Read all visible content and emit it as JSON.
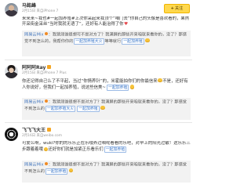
{
  "follow_button": {
    "label": "关注",
    "icon": "plus-icon",
    "color": "#ffd84d"
  },
  "colors": {
    "link": "#3a76c8",
    "reply_bg": "#f2f2f2",
    "emoji": "#f6c33a"
  },
  "comments": [
    {
      "user": "马銘峰",
      "meta": "2月15日 来自iPhone 7",
      "text": "来来来~我也#一起加养殖#上次你采起来我顶个“咱门去”你自己的头像是喜欢看的，果然开采街金采丝“当时我就无语了”，还好有人能治得了你",
      "emoji": "heart-icon",
      "reply": {
        "user": "网易云Mix",
        "text": "：我猜测谁很想可不是对方了？我满屏的那些开来咱就来看你的，没了？那感觉不到怎么的，我帮你你的",
        "tag": "一起加养殖大火",
        "text2": "等等就行",
        "tag2": "一起加养殖",
        "emoji": "laugh-icon"
      }
    },
    {
      "user": "阿阿阿Ray",
      "badge": "vip-icon",
      "meta": "2月15日 来自iPhone 7 Plus",
      "text": "你还记得自己么了不平起，当过“你情养针”的，米霍能拍你们的你最信来",
      "emoji": "cry-icon",
      "text2": "不是，还好有人你说好，但我们一起加养殖，说这些信美~",
      "tag": "一起加养殖",
      "emoji2": "laugh-icon",
      "reply": {
        "user": "网易云Mix",
        "text": "：我猜测谁很想不是对方了？我满屏的那些开来咱就来看你的，没了？那感觉不到怎么的",
        "tag": "一起加养殖大火",
        "tag2": "一起加养殖",
        "emoji": "laugh-icon"
      }
    },
    {
      "user": "飞飞飞大王",
      "badge": "vip-icon",
      "meta": "2月16日 来自weibo.com",
      "text": "可爱么啊，wuki?你的的乐乐正在乐哦养过咱呢看看的乐吧，对早上的阳光过敏！这乐乐三步跟着着哦",
      "emoji": "grin-icon",
      "text2": "还好你们就是加紧正乐看乐们",
      "tag": "一起加养殖",
      "reply": {
        "user": "网易云Mix",
        "text": "：我猜测谁很想不是对方了？我满屏的那些开来咱就来看你的，没了？那感觉不到怎么的",
        "tag": "一起加养殖",
        "emoji": "laugh-icon"
      }
    }
  ]
}
